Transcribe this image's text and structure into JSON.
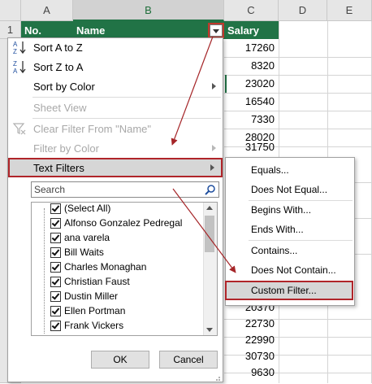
{
  "sheet": {
    "columns": [
      "A",
      "B",
      "C",
      "D",
      "E"
    ],
    "row_number": "1",
    "headers": {
      "no": "No.",
      "name": "Name",
      "salary": "Salary"
    },
    "salaries_top": [
      "17260",
      "8320",
      "23020",
      "16540",
      "7330",
      "28020",
      "31750"
    ],
    "salaries_bottom": [
      "20370",
      "22730",
      "22990",
      "30730",
      "9630"
    ]
  },
  "menu": {
    "sort_a_z": "Sort A to Z",
    "sort_z_a": "Sort Z to A",
    "sort_color": "Sort by Color",
    "sheet_view": "Sheet View",
    "clear_filter": "Clear Filter From \"Name\"",
    "filter_color": "Filter by Color",
    "text_filters": "Text Filters",
    "search_placeholder": "Search",
    "items": [
      "(Select All)",
      "Alfonso Gonzalez Pedregal",
      "ana varela",
      "Bill Waits",
      "Charles Monaghan",
      "Christian Faust",
      "Dustin Miller",
      "Ellen Portman",
      "Frank Vickers"
    ],
    "ok": "OK",
    "cancel": "Cancel"
  },
  "submenu": {
    "equals": "Equals...",
    "not_equal": "Does Not Equal...",
    "begins": "Begins With...",
    "ends": "Ends With...",
    "contains": "Contains...",
    "not_contain": "Does Not Contain...",
    "custom": "Custom Filter..."
  },
  "colors": {
    "header_green": "#217346",
    "highlight_red": "#b0252a"
  }
}
